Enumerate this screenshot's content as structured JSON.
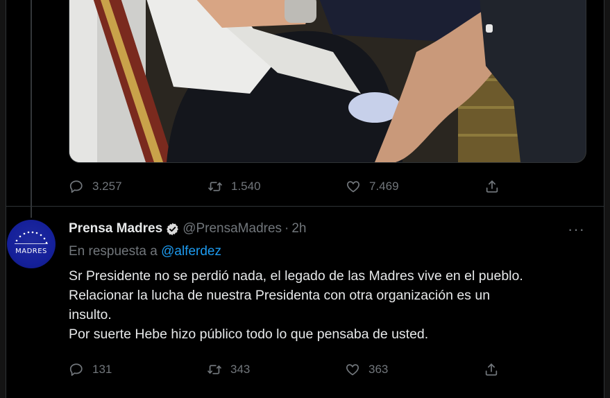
{
  "first_tweet": {
    "photo_alt": "",
    "actions": {
      "replies": "3.257",
      "retweets": "1.540",
      "likes": "7.469"
    }
  },
  "reply_tweet": {
    "author_name": "Prensa Madres",
    "handle": "@PrensaMadres",
    "separator": "·",
    "time": "2h",
    "reply_prefix": "En respuesta a",
    "reply_target": "@alferdez",
    "avatar_text": "MADRES",
    "text_lines": [
      "Sr Presidente no se perdió nada, el legado de las Madres vive en el pueblo.",
      "Relacionar la lucha de nuestra Presidenta con otra organización es un",
      "insulto.",
      "Por suerte Hebe hizo público todo lo que pensaba de usted."
    ],
    "actions": {
      "replies": "131",
      "retweets": "343",
      "likes": "363"
    },
    "more_label": "···"
  },
  "colors": {
    "background": "#000000",
    "text": "#e7e9ea",
    "muted": "#71767b",
    "link": "#1d9bf0",
    "verified": "#d9d9d9"
  },
  "icons": [
    "reply-icon",
    "retweet-icon",
    "like-icon",
    "share-icon",
    "verified-badge-icon",
    "more-icon"
  ]
}
